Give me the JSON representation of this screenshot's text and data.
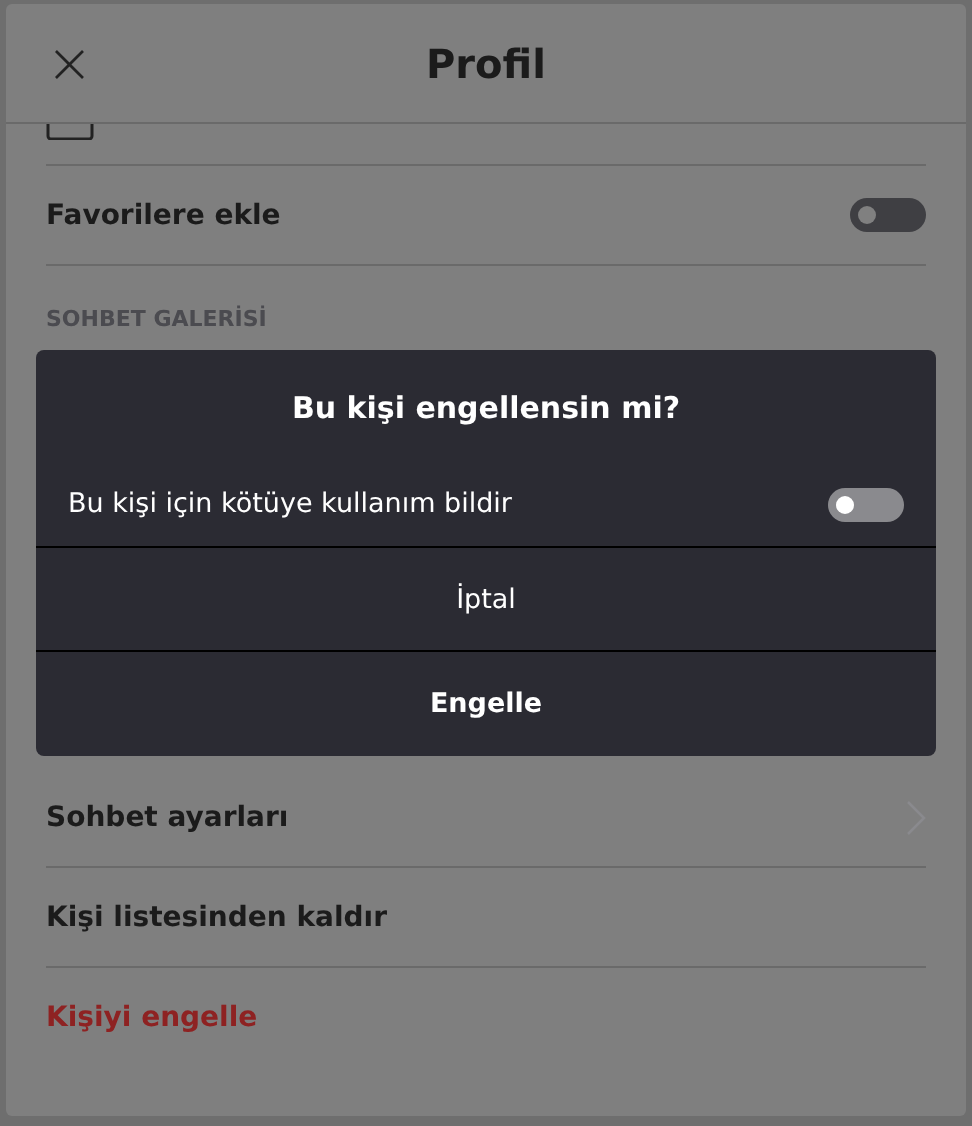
{
  "header": {
    "title": "Profil",
    "close": "×"
  },
  "rows_top": [
    {
      "kind": "toggle",
      "label": "Favorilere ekle",
      "on": false
    },
    {
      "kind": "section",
      "label": "SOHBET GALERİSİ"
    }
  ],
  "dialog": {
    "title": "Bu kişi engellensin mi?",
    "option": {
      "label": "Bu kişi için kötüye kullanım bildir",
      "on": false
    },
    "buttons": [
      {
        "label": "İptal",
        "primary": false
      },
      {
        "label": "Engelle",
        "primary": true
      }
    ]
  },
  "rows_bottom": [
    {
      "kind": "nav",
      "label": "Sohbet ayarları"
    },
    {
      "kind": "action",
      "label": "Kişi listesinden kaldır"
    },
    {
      "kind": "danger",
      "label": "Kişiyi engelle"
    }
  ]
}
